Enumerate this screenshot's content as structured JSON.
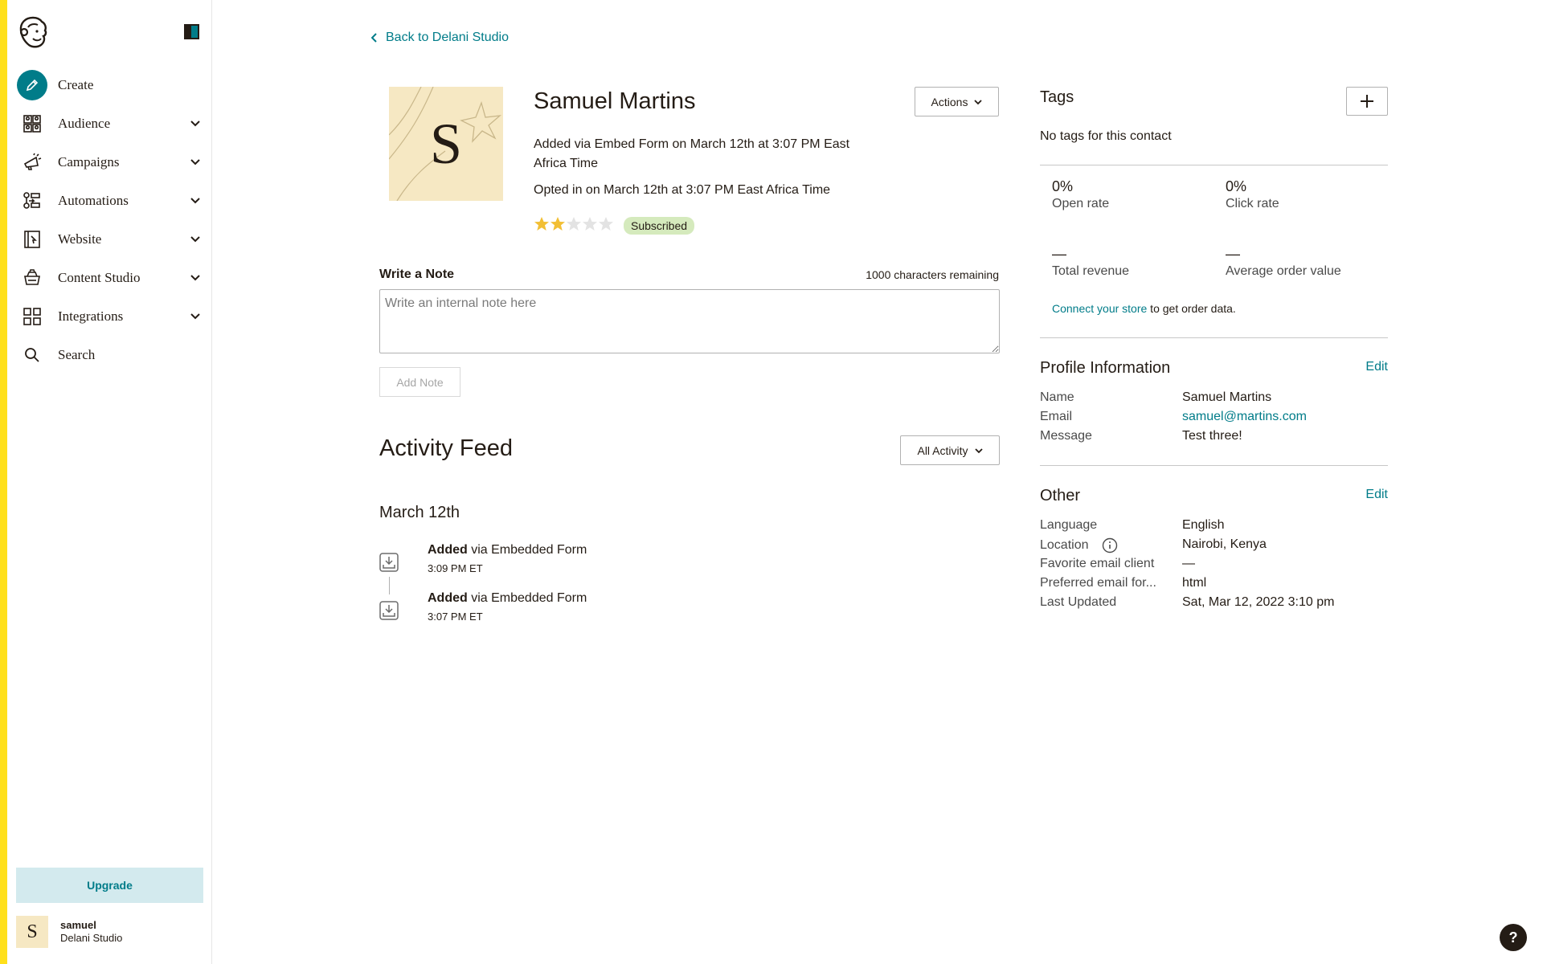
{
  "app": {
    "accent_color": "#007c89",
    "brand_color": "#ffe01b"
  },
  "sidebar": {
    "logo_icon": "mailchimp-freddie-logo",
    "collapse_icon": "panel-collapse-icon",
    "items": [
      {
        "label": "Create",
        "icon": "pencil-icon"
      },
      {
        "label": "Audience",
        "icon": "audience-icon"
      },
      {
        "label": "Campaigns",
        "icon": "megaphone-icon"
      },
      {
        "label": "Automations",
        "icon": "automation-icon"
      },
      {
        "label": "Website",
        "icon": "website-icon"
      },
      {
        "label": "Content Studio",
        "icon": "content-studio-icon"
      },
      {
        "label": "Integrations",
        "icon": "grid-icon"
      },
      {
        "label": "Search",
        "icon": "search-icon"
      }
    ],
    "upgrade_label": "Upgrade",
    "account": {
      "avatar_initial": "S",
      "name": "samuel",
      "org": "Delani Studio"
    }
  },
  "header": {
    "back_label": "Back to Delani Studio"
  },
  "contact": {
    "avatar_initial": "S",
    "name": "Samuel Martins",
    "added_text": "Added via Embed Form on March 12th at 3:07 PM East Africa Time",
    "optin_text": "Opted in on March 12th at 3:07 PM East Africa Time",
    "rating": 2,
    "rating_max": 5,
    "status_badge": "Subscribed",
    "actions_label": "Actions"
  },
  "note": {
    "label": "Write a Note",
    "remaining": "1000 characters remaining",
    "placeholder": "Write an internal note here",
    "add_label": "Add Note"
  },
  "activity": {
    "title": "Activity Feed",
    "filter_label": "All Activity",
    "date_heading": "March 12th",
    "items": [
      {
        "action": "Added",
        "detail": " via Embedded Form",
        "time": "3:09 PM ET"
      },
      {
        "action": "Added",
        "detail": " via Embedded Form",
        "time": "3:07 PM ET"
      }
    ]
  },
  "tags": {
    "title": "Tags",
    "empty_text": "No tags for this contact"
  },
  "stats": {
    "open_rate": {
      "value": "0%",
      "label": "Open rate"
    },
    "click_rate": {
      "value": "0%",
      "label": "Click rate"
    },
    "total_revenue": {
      "value": "—",
      "label": "Total revenue"
    },
    "avg_order": {
      "value": "—",
      "label": "Average order value"
    },
    "store_link": "Connect your store",
    "store_suffix": " to get order data."
  },
  "profile": {
    "title": "Profile Information",
    "edit_label": "Edit",
    "fields": [
      {
        "key": "Name",
        "value": "Samuel Martins"
      },
      {
        "key": "Email",
        "value": "samuel@martins.com"
      },
      {
        "key": "Message",
        "value": "Test three!"
      }
    ]
  },
  "other": {
    "title": "Other",
    "edit_label": "Edit",
    "fields": [
      {
        "key": "Language",
        "value": "English"
      },
      {
        "key": "Location",
        "value": "Nairobi, Kenya"
      },
      {
        "key": "Favorite email client",
        "value": "—"
      },
      {
        "key": "Preferred email for...",
        "value": "html"
      },
      {
        "key": "Last Updated",
        "value": "Sat, Mar 12, 2022 3:10 pm"
      }
    ]
  },
  "help": {
    "label": "?"
  }
}
